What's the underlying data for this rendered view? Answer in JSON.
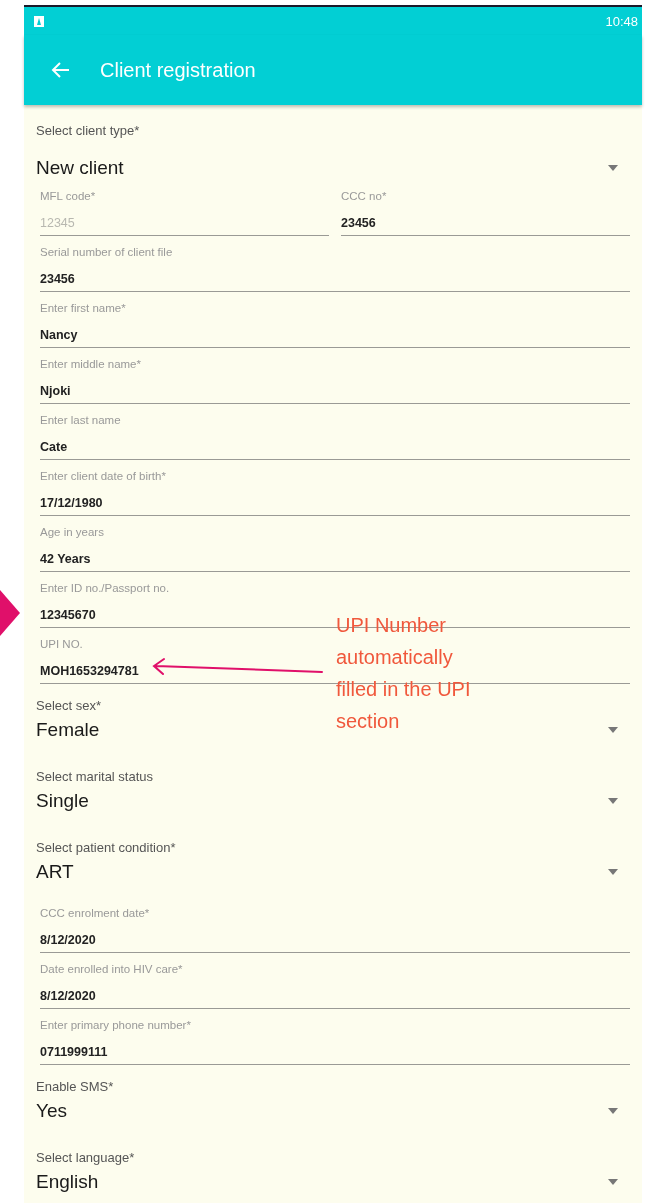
{
  "status_bar": {
    "time": "10:48"
  },
  "app_bar": {
    "title": "Client registration"
  },
  "form": [
    {
      "kind": "spinner",
      "label": "Select client type*",
      "value": "New client"
    },
    {
      "kind": "pair",
      "fields": [
        {
          "label": "MFL code*",
          "value": "12345",
          "disabled": true
        },
        {
          "label": "CCC no*",
          "value": "23456",
          "disabled": false
        }
      ]
    },
    {
      "kind": "text",
      "label": "Serial number of client file",
      "value": "23456"
    },
    {
      "kind": "text",
      "label": "Enter  first name*",
      "value": "Nancy"
    },
    {
      "kind": "text",
      "label": "Enter middle name*",
      "value": "Njoki"
    },
    {
      "kind": "text",
      "label": "Enter  last name",
      "value": "Cate"
    },
    {
      "kind": "text",
      "label": "Enter client date of birth*",
      "value": "17/12/1980"
    },
    {
      "kind": "text",
      "label": "Age in years",
      "value": "42 Years"
    },
    {
      "kind": "text",
      "label": "Enter ID no./Passport no.",
      "value": "12345670"
    },
    {
      "kind": "text",
      "label": "UPI NO.",
      "value": "MOH1653294781"
    },
    {
      "kind": "spinner",
      "label": "Select sex*",
      "value": "Female"
    },
    {
      "kind": "spinner",
      "label": "Select marital status",
      "value": "Single"
    },
    {
      "kind": "spinner",
      "label": "Select patient condition*",
      "value": "ART"
    },
    {
      "kind": "text",
      "label": "CCC enrolment date*",
      "value": "8/12/2020"
    },
    {
      "kind": "text",
      "label": "Date enrolled into HIV care*",
      "value": "8/12/2020"
    },
    {
      "kind": "text",
      "label": "Enter primary phone number*",
      "value": "0711999111"
    },
    {
      "kind": "spinner",
      "label": "Enable SMS*",
      "value": "Yes"
    },
    {
      "kind": "spinner",
      "label": "Select language*",
      "value": "English"
    }
  ],
  "annotation": {
    "text": "UPI Number automatically filled in the UPI section"
  }
}
